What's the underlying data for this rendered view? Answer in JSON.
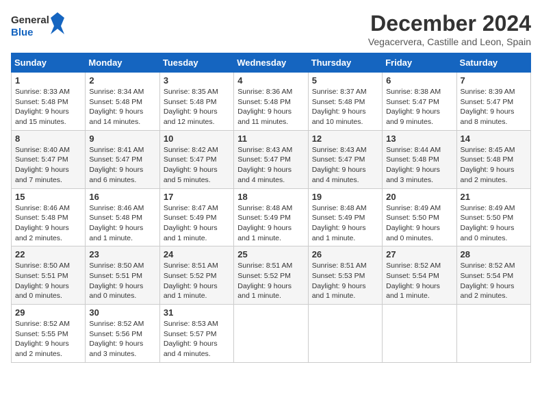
{
  "logo": {
    "line1": "General",
    "line2": "Blue"
  },
  "title": "December 2024",
  "subtitle": "Vegacervera, Castille and Leon, Spain",
  "headers": [
    "Sunday",
    "Monday",
    "Tuesday",
    "Wednesday",
    "Thursday",
    "Friday",
    "Saturday"
  ],
  "weeks": [
    [
      {
        "day": "1",
        "sunrise": "8:33 AM",
        "sunset": "5:48 PM",
        "daylight": "9 hours and 15 minutes."
      },
      {
        "day": "2",
        "sunrise": "8:34 AM",
        "sunset": "5:48 PM",
        "daylight": "9 hours and 14 minutes."
      },
      {
        "day": "3",
        "sunrise": "8:35 AM",
        "sunset": "5:48 PM",
        "daylight": "9 hours and 12 minutes."
      },
      {
        "day": "4",
        "sunrise": "8:36 AM",
        "sunset": "5:48 PM",
        "daylight": "9 hours and 11 minutes."
      },
      {
        "day": "5",
        "sunrise": "8:37 AM",
        "sunset": "5:48 PM",
        "daylight": "9 hours and 10 minutes."
      },
      {
        "day": "6",
        "sunrise": "8:38 AM",
        "sunset": "5:47 PM",
        "daylight": "9 hours and 9 minutes."
      },
      {
        "day": "7",
        "sunrise": "8:39 AM",
        "sunset": "5:47 PM",
        "daylight": "9 hours and 8 minutes."
      }
    ],
    [
      {
        "day": "8",
        "sunrise": "8:40 AM",
        "sunset": "5:47 PM",
        "daylight": "9 hours and 7 minutes."
      },
      {
        "day": "9",
        "sunrise": "8:41 AM",
        "sunset": "5:47 PM",
        "daylight": "9 hours and 6 minutes."
      },
      {
        "day": "10",
        "sunrise": "8:42 AM",
        "sunset": "5:47 PM",
        "daylight": "9 hours and 5 minutes."
      },
      {
        "day": "11",
        "sunrise": "8:43 AM",
        "sunset": "5:47 PM",
        "daylight": "9 hours and 4 minutes."
      },
      {
        "day": "12",
        "sunrise": "8:43 AM",
        "sunset": "5:47 PM",
        "daylight": "9 hours and 4 minutes."
      },
      {
        "day": "13",
        "sunrise": "8:44 AM",
        "sunset": "5:48 PM",
        "daylight": "9 hours and 3 minutes."
      },
      {
        "day": "14",
        "sunrise": "8:45 AM",
        "sunset": "5:48 PM",
        "daylight": "9 hours and 2 minutes."
      }
    ],
    [
      {
        "day": "15",
        "sunrise": "8:46 AM",
        "sunset": "5:48 PM",
        "daylight": "9 hours and 2 minutes."
      },
      {
        "day": "16",
        "sunrise": "8:46 AM",
        "sunset": "5:48 PM",
        "daylight": "9 hours and 1 minute."
      },
      {
        "day": "17",
        "sunrise": "8:47 AM",
        "sunset": "5:49 PM",
        "daylight": "9 hours and 1 minute."
      },
      {
        "day": "18",
        "sunrise": "8:48 AM",
        "sunset": "5:49 PM",
        "daylight": "9 hours and 1 minute."
      },
      {
        "day": "19",
        "sunrise": "8:48 AM",
        "sunset": "5:49 PM",
        "daylight": "9 hours and 1 minute."
      },
      {
        "day": "20",
        "sunrise": "8:49 AM",
        "sunset": "5:50 PM",
        "daylight": "9 hours and 0 minutes."
      },
      {
        "day": "21",
        "sunrise": "8:49 AM",
        "sunset": "5:50 PM",
        "daylight": "9 hours and 0 minutes."
      }
    ],
    [
      {
        "day": "22",
        "sunrise": "8:50 AM",
        "sunset": "5:51 PM",
        "daylight": "9 hours and 0 minutes."
      },
      {
        "day": "23",
        "sunrise": "8:50 AM",
        "sunset": "5:51 PM",
        "daylight": "9 hours and 0 minutes."
      },
      {
        "day": "24",
        "sunrise": "8:51 AM",
        "sunset": "5:52 PM",
        "daylight": "9 hours and 1 minute."
      },
      {
        "day": "25",
        "sunrise": "8:51 AM",
        "sunset": "5:52 PM",
        "daylight": "9 hours and 1 minute."
      },
      {
        "day": "26",
        "sunrise": "8:51 AM",
        "sunset": "5:53 PM",
        "daylight": "9 hours and 1 minute."
      },
      {
        "day": "27",
        "sunrise": "8:52 AM",
        "sunset": "5:54 PM",
        "daylight": "9 hours and 1 minute."
      },
      {
        "day": "28",
        "sunrise": "8:52 AM",
        "sunset": "5:54 PM",
        "daylight": "9 hours and 2 minutes."
      }
    ],
    [
      {
        "day": "29",
        "sunrise": "8:52 AM",
        "sunset": "5:55 PM",
        "daylight": "9 hours and 2 minutes."
      },
      {
        "day": "30",
        "sunrise": "8:52 AM",
        "sunset": "5:56 PM",
        "daylight": "9 hours and 3 minutes."
      },
      {
        "day": "31",
        "sunrise": "8:53 AM",
        "sunset": "5:57 PM",
        "daylight": "9 hours and 4 minutes."
      },
      null,
      null,
      null,
      null
    ]
  ],
  "labels": {
    "sunrise": "Sunrise:",
    "sunset": "Sunset:",
    "daylight": "Daylight:"
  }
}
